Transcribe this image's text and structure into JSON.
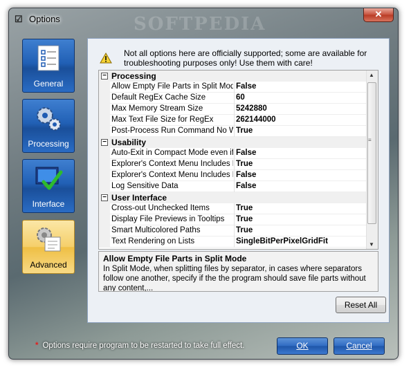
{
  "window": {
    "title": "Options",
    "watermark": "SOFTPEDIA",
    "close_glyph": "✕"
  },
  "sidebar": {
    "items": [
      {
        "label": "General",
        "icon": "checklist-icon",
        "active": false
      },
      {
        "label": "Processing",
        "icon": "gears-icon",
        "active": false
      },
      {
        "label": "Interface",
        "icon": "monitor-check-icon",
        "active": false
      },
      {
        "label": "Advanced",
        "icon": "advanced-gear-icon",
        "active": true
      }
    ]
  },
  "notice": {
    "text": "Not all options here are officially supported; some are available for troubleshooting purposes only! Use them with care!"
  },
  "grid": {
    "categories": [
      {
        "name": "Processing",
        "props": [
          {
            "name": "Allow Empty File Parts in Split Mode",
            "value": "False"
          },
          {
            "name": "Default RegEx Cache Size",
            "value": "60"
          },
          {
            "name": "Max Memory Stream Size",
            "value": "5242880"
          },
          {
            "name": "Max Text File Size for RegEx",
            "value": "262144000"
          },
          {
            "name": "Post-Process Run Command No Win",
            "value": "True"
          }
        ]
      },
      {
        "name": "Usability",
        "props": [
          {
            "name": "Auto-Exit in Compact Mode even if Er",
            "value": "False"
          },
          {
            "name": "Explorer's Context Menu Includes Fol",
            "value": "True"
          },
          {
            "name": "Explorer's Context Menu Includes Fol",
            "value": "False"
          },
          {
            "name": "Log Sensitive Data",
            "value": "False"
          }
        ]
      },
      {
        "name": "User Interface",
        "props": [
          {
            "name": "Cross-out Unchecked Items",
            "value": "True"
          },
          {
            "name": "Display File Previews in Tooltips",
            "value": "True"
          },
          {
            "name": "Smart Multicolored Paths",
            "value": "True"
          },
          {
            "name": "Text Rendering on Lists",
            "value": "SingleBitPerPixelGridFit"
          }
        ]
      }
    ],
    "collapse_glyph": "−"
  },
  "description": {
    "title": "Allow Empty File Parts in Split Mode",
    "body": "In Split Mode, when splitting files by separator, in cases where separators follow one another, specify if the the program should save file parts without any content,..."
  },
  "buttons": {
    "reset": "Reset All",
    "ok": "OK",
    "cancel": "Cancel"
  },
  "footnote": {
    "star": "*",
    "text": "Options require program to be restarted to take full effect."
  }
}
